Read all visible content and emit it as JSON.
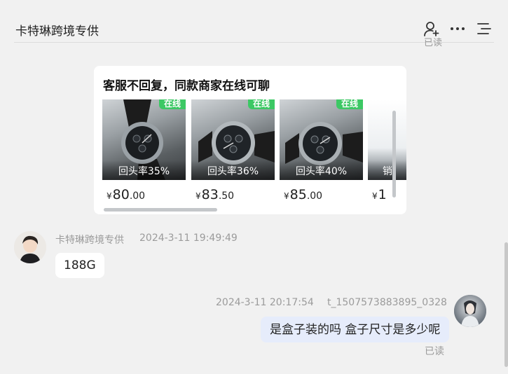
{
  "header": {
    "title": "卡特琳跨境专供",
    "icons": [
      "user-add-icon",
      "more-icon",
      "menu-list-icon"
    ]
  },
  "previous_message": {
    "read_status": "已读"
  },
  "recommendation_card": {
    "title": "客服不回复，同款商家在线可聊",
    "products": [
      {
        "online_badge": "在线",
        "return_rate": "回头率35%",
        "currency": "¥",
        "price_int": "80",
        "price_dec": ".00"
      },
      {
        "online_badge": "在线",
        "return_rate": "回头率36%",
        "currency": "¥",
        "price_int": "83",
        "price_dec": ".50"
      },
      {
        "online_badge": "在线",
        "return_rate": "回头率40%",
        "currency": "¥",
        "price_int": "85",
        "price_dec": ".00"
      },
      {
        "online_badge": "",
        "return_rate": "销",
        "currency": "¥",
        "price_int": "1",
        "price_dec": ""
      }
    ]
  },
  "messages": [
    {
      "side": "left",
      "sender": "卡特琳跨境专供",
      "time": "2024-3-11 19:49:49",
      "text": "188G"
    },
    {
      "side": "right",
      "sender": "t_1507573883895_0328",
      "time": "2024-3-11 20:17:54",
      "text": "是盒子装的吗 盒子尺寸是多少呢",
      "read_status": "已读"
    }
  ],
  "colors": {
    "background": "#f1f1f1",
    "online_badge": "#3cc864",
    "own_bubble": "#e6ecfb"
  }
}
